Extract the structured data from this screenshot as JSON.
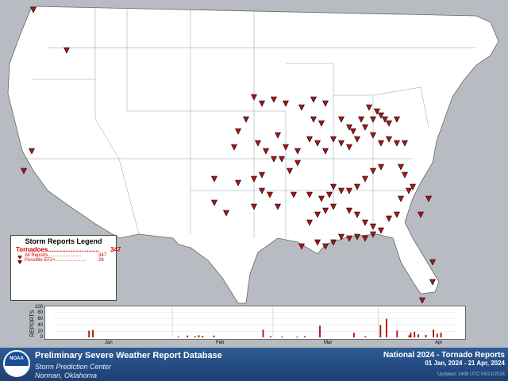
{
  "legend": {
    "title": "Storm Reports Legend",
    "tornadoes_label": "Tornadoes.............................",
    "tornadoes_value": "347",
    "all_label": "All Reports.........................",
    "all_value": "347",
    "ef2_label": "Possible EF2+.......................",
    "ef2_value": "26"
  },
  "chart": {
    "ylabel": "REPORTS",
    "yticks": [
      "100",
      "80",
      "60",
      "40",
      "20",
      "0"
    ],
    "months": [
      "Jan",
      "Feb",
      "Mar",
      "Apr"
    ],
    "daily_counts": [
      22,
      24,
      3,
      6,
      4,
      7,
      5,
      6,
      25,
      4,
      3,
      3,
      4,
      38,
      15,
      4,
      40,
      60,
      22,
      7,
      15,
      18,
      10,
      8,
      25,
      12,
      15
    ]
  },
  "footer": {
    "title": "Preliminary Severe Weather Report Database",
    "center": "Storm Prediction Center",
    "location": "Norman, Oklahoma",
    "right_title": "National  2024 - Tornado Reports",
    "date_range": "01 Jan, 2024 - 21 Apr, 2024",
    "updated": "Updated: 1408 UTC 04/21/2024",
    "logo_text": "NOAA"
  },
  "colors": {
    "marker": "#b01515",
    "land": "#ffffff",
    "water": "#b8bcc2",
    "banner": "#2a5590"
  }
}
